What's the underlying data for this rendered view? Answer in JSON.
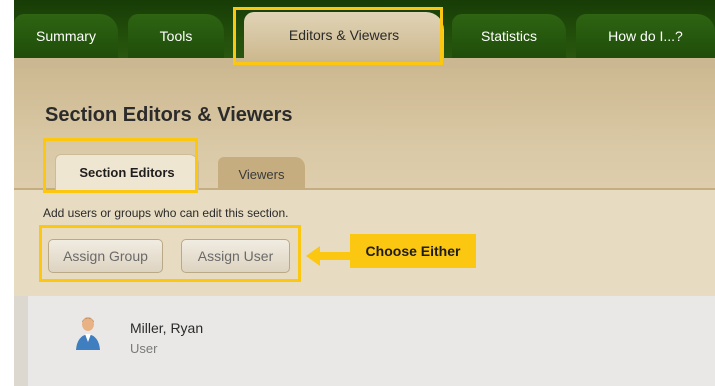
{
  "top_tabs": [
    "Summary",
    "Tools",
    "Editors & Viewers",
    "Statistics",
    "How do I...?"
  ],
  "active_top_tab": "Editors & Viewers",
  "section": {
    "title": "Section Editors & Viewers",
    "tabs": [
      "Section Editors",
      "Viewers"
    ],
    "instructions": "Add users or groups who can edit this section.",
    "buttons": {
      "assign_group": "Assign Group",
      "assign_user": "Assign User"
    }
  },
  "callout": "Choose Either",
  "members": [
    {
      "name": "Miller, Ryan",
      "role": "User"
    }
  ],
  "colors": {
    "highlight": "#fcc710",
    "tabbar": "#24510b",
    "panel": "#dac9a6"
  }
}
